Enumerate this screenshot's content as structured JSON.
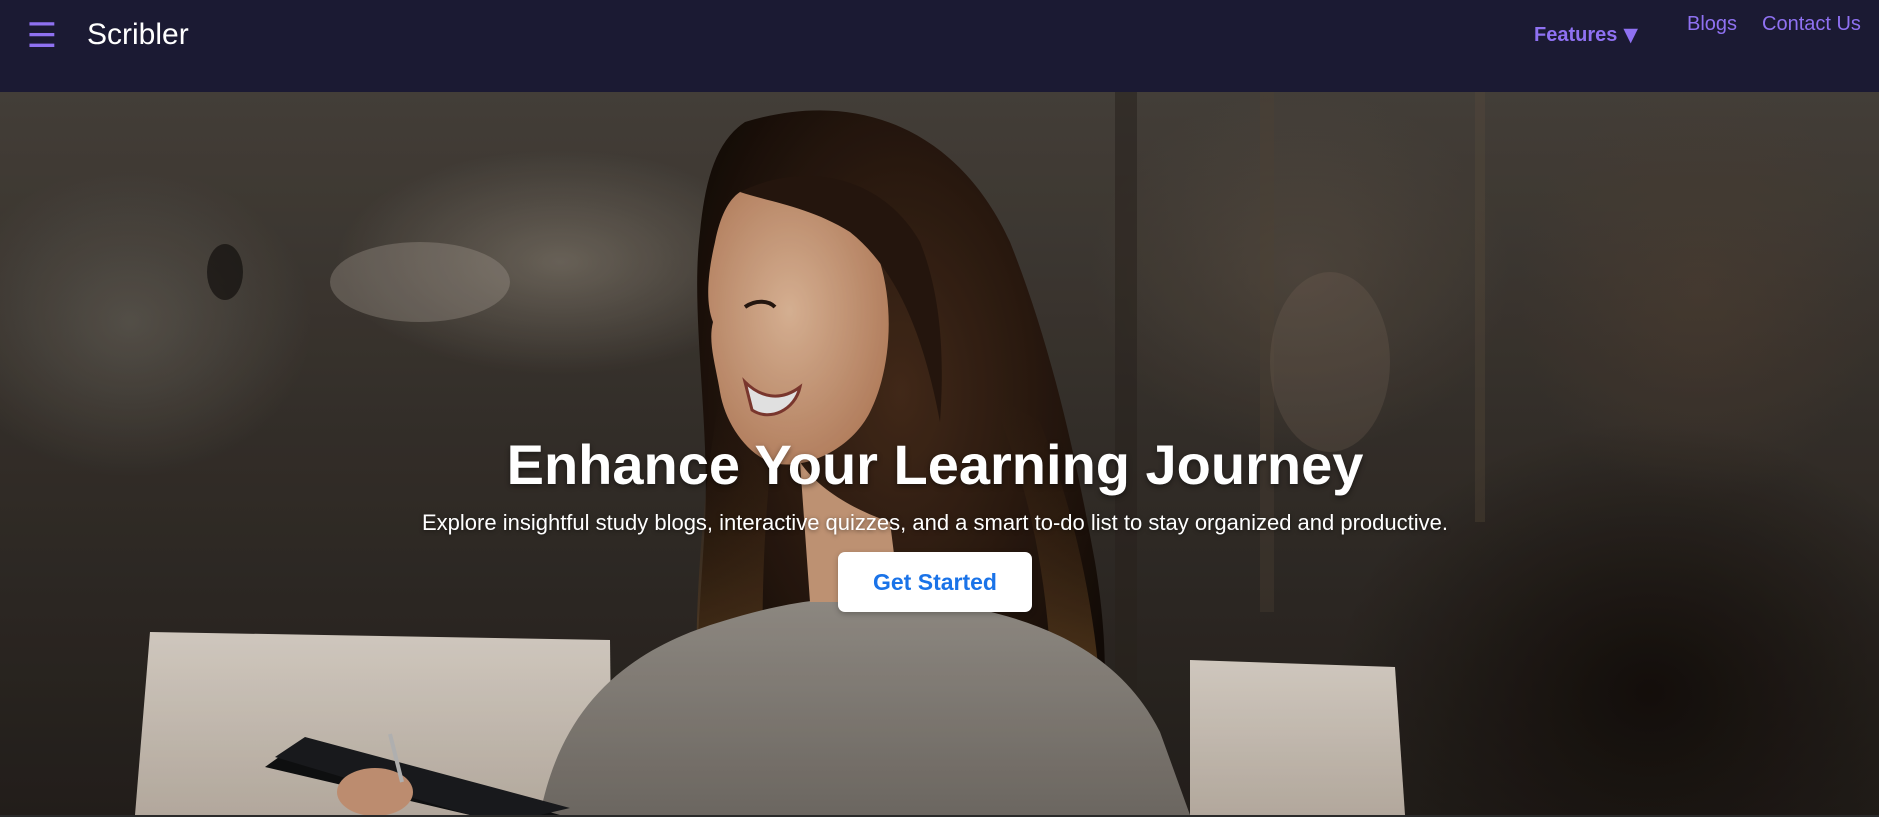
{
  "navbar": {
    "menu_icon": "hamburger-menu-icon",
    "menu_glyph": "☰",
    "brand": "Scribler",
    "features_label": "Features",
    "features_caret": "▼",
    "links": [
      {
        "label": "Blogs"
      },
      {
        "label": "Contact Us"
      }
    ]
  },
  "hero": {
    "title": "Enhance Your Learning Journey",
    "subtitle": "Explore insightful study blogs, interactive quizzes, and a smart to-do list to stay organized and productive.",
    "cta_label": "Get Started",
    "image_subject": "smiling woman with long hair holding a tablet and stylus in front of a distressed dark wall"
  },
  "colors": {
    "nav_bg": "#1b1a33",
    "accent": "#8f71f2",
    "cta_text": "#1a73e8",
    "cta_bg": "#ffffff"
  }
}
